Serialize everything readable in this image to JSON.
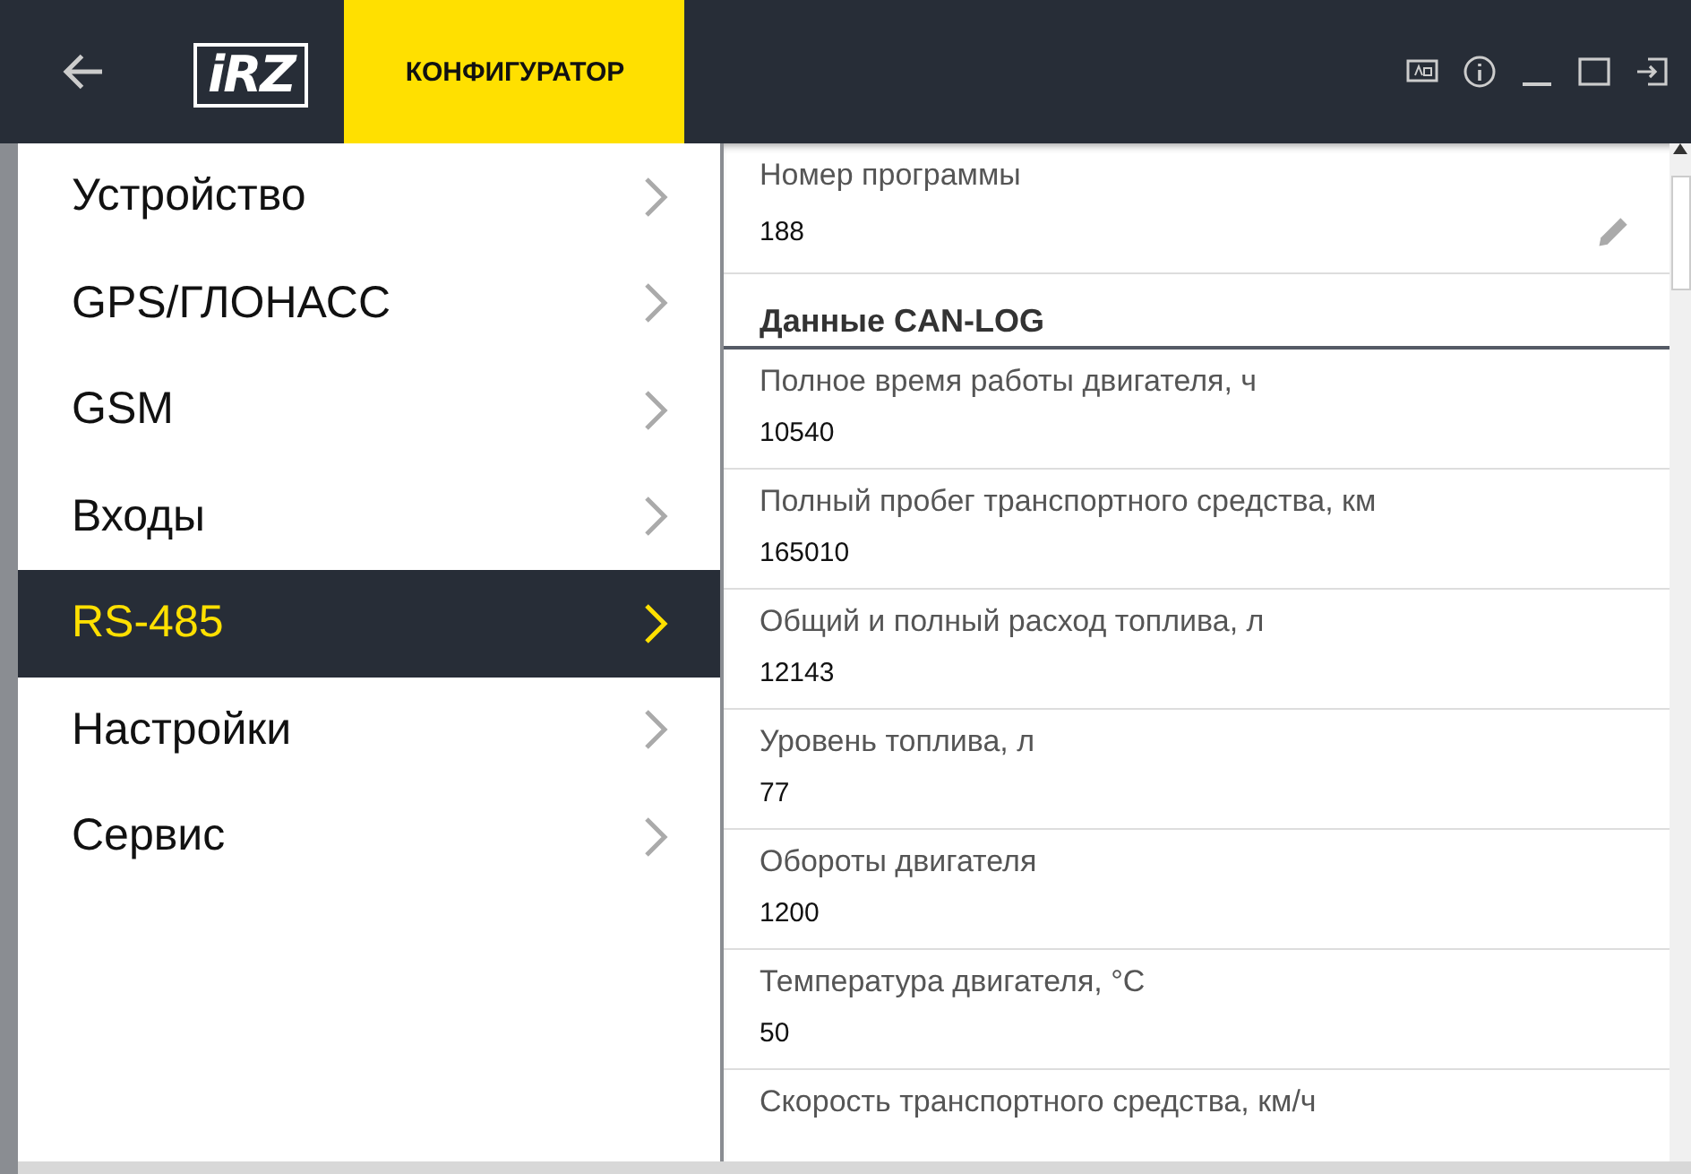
{
  "header": {
    "logo": "iRZ",
    "title": "КОНФИГУРАТОР"
  },
  "sidebar": {
    "items": [
      {
        "label": "Устройство",
        "selected": false
      },
      {
        "label": "GPS/ГЛОНАСС",
        "selected": false
      },
      {
        "label": "GSM",
        "selected": false
      },
      {
        "label": "Входы",
        "selected": false
      },
      {
        "label": "RS-485",
        "selected": true
      },
      {
        "label": "Настройки",
        "selected": false
      },
      {
        "label": "Сервис",
        "selected": false
      }
    ]
  },
  "content": {
    "items": [
      {
        "kind": "field",
        "label": "Номер программы",
        "value": "188",
        "editable": true
      },
      {
        "kind": "section",
        "label": "Данные CAN-LOG"
      },
      {
        "kind": "field",
        "label": "Полное время работы двигателя, ч",
        "value": "10540",
        "editable": false
      },
      {
        "kind": "field",
        "label": "Полный пробег транспортного средства, км",
        "value": "165010",
        "editable": false
      },
      {
        "kind": "field",
        "label": "Общий и полный расход топлива, л",
        "value": "12143",
        "editable": false
      },
      {
        "kind": "field",
        "label": "Уровень топлива, л",
        "value": "77",
        "editable": false
      },
      {
        "kind": "field",
        "label": "Обороты двигателя",
        "value": "1200",
        "editable": false
      },
      {
        "kind": "field",
        "label": "Температура двигателя, °C",
        "value": "50",
        "editable": false
      },
      {
        "kind": "field",
        "label": "Скорость транспортного средства, км/ч",
        "editable": false
      }
    ]
  }
}
